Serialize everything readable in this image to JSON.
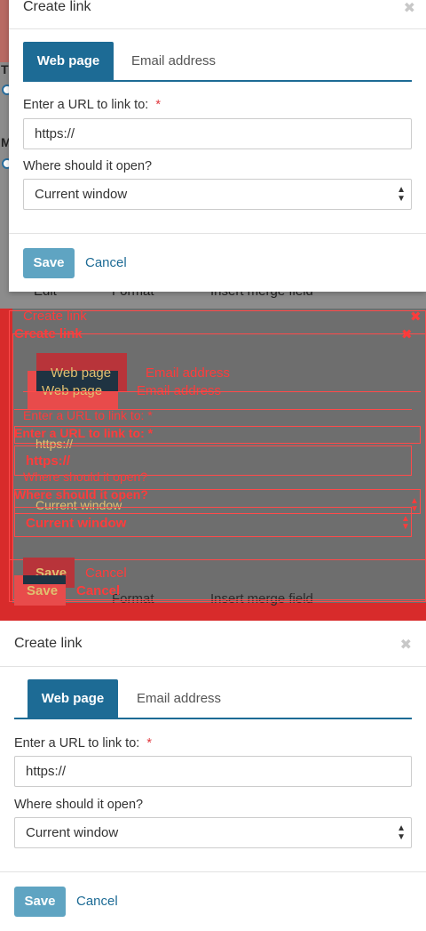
{
  "dialog": {
    "title": "Create link",
    "close_icon": "close-icon",
    "tabs": [
      {
        "label": "Web page",
        "active": true
      },
      {
        "label": "Email address",
        "active": false
      }
    ],
    "url_label": "Enter a URL to link to:",
    "required_mark": "*",
    "url_value": "https://",
    "open_label": "Where should it open?",
    "open_value": "Current window",
    "save_label": "Save",
    "cancel_label": "Cancel"
  },
  "background": {
    "toolbar": [
      "Edit",
      "Format",
      "Insert merge field"
    ]
  },
  "colors": {
    "accent": "#1d6b95",
    "save_button": "#5fa4c2",
    "required": "#e0383e",
    "overlay_red": "#ff3b3b"
  }
}
